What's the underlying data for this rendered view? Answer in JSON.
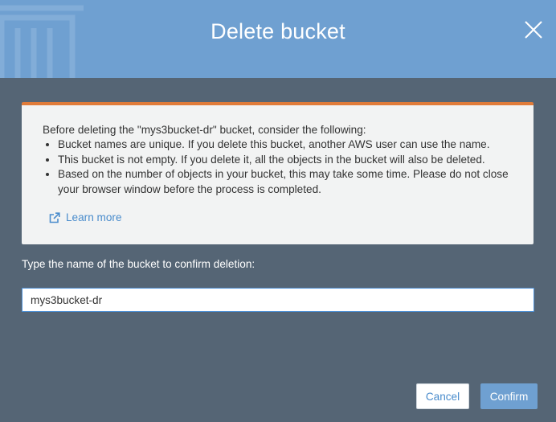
{
  "dialog": {
    "title": "Delete bucket",
    "close_icon": "close-icon",
    "header_icon": "trash-icon"
  },
  "notice": {
    "intro": "Before deleting the \"mys3bucket-dr\" bucket, consider the following:",
    "items": [
      "Bucket names are unique. If you delete this bucket, another AWS user can use the name.",
      "This bucket is not empty. If you delete it, all the objects in the bucket will also be deleted.",
      "Based on the number of objects in your bucket, this may take some time. Please do not close your browser window before the process is completed."
    ],
    "learn_more": "Learn more",
    "learn_more_icon": "external-link-icon",
    "accent_color": "#e07b39"
  },
  "form": {
    "label": "Type the name of the bucket to confirm deletion:",
    "input_value": "mys3bucket-dr"
  },
  "actions": {
    "cancel_label": "Cancel",
    "confirm_label": "Confirm"
  },
  "colors": {
    "header": "#6fa0d1",
    "body": "#556575",
    "link": "#4a8ccc"
  }
}
